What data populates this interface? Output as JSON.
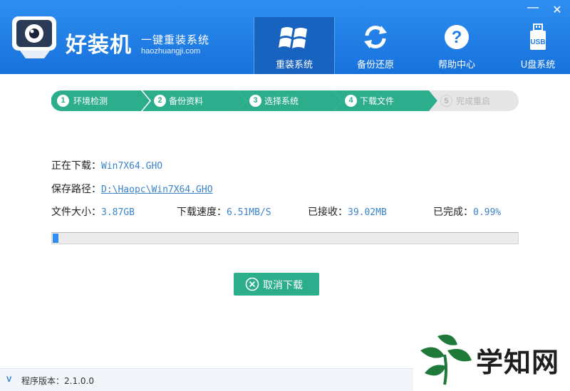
{
  "brand": {
    "title": "好装机",
    "slogan": "一键重装系统",
    "domain": "haozhuangji.com"
  },
  "window": {
    "minimize": "—",
    "close": "✕"
  },
  "nav": [
    {
      "label": "重装系统",
      "icon": "windows-icon",
      "active": true
    },
    {
      "label": "备份还原",
      "icon": "refresh-icon",
      "active": false
    },
    {
      "label": "帮助中心",
      "icon": "help-icon",
      "active": false
    },
    {
      "label": "U盘系统",
      "icon": "usb-icon",
      "active": false
    }
  ],
  "usb_badge": "USB",
  "help_glyph": "?",
  "steps": [
    {
      "num": "1",
      "label": "环境检测",
      "state": "done"
    },
    {
      "num": "2",
      "label": "备份资料",
      "state": "done"
    },
    {
      "num": "3",
      "label": "选择系统",
      "state": "done"
    },
    {
      "num": "4",
      "label": "下载文件",
      "state": "current"
    },
    {
      "num": "5",
      "label": "完成重启",
      "state": "pending"
    }
  ],
  "download": {
    "downloading_label": "正在下载：",
    "filename": "Win7X64.GHO",
    "path_label": "保存路径：",
    "path": "D:\\Haopc\\Win7X64.GHO",
    "size_label": "文件大小：",
    "size": "3.87GB",
    "speed_label": "下载速度：",
    "speed": "6.51MB/S",
    "received_label": "已接收：",
    "received": "39.02MB",
    "completed_label": "已完成：",
    "completed": "0.99%",
    "progress": 0.0099
  },
  "cancel_label": "取消下载",
  "footer": {
    "v_badge": "V",
    "version": "程序版本：2.1.0.0"
  },
  "watermark": {
    "text": "学知网"
  },
  "colors": {
    "header_blue": "#1f7ee6",
    "step_green": "#2cae8d",
    "progress_blue": "#2f8ef0",
    "value_blue": "#3a84c9"
  }
}
